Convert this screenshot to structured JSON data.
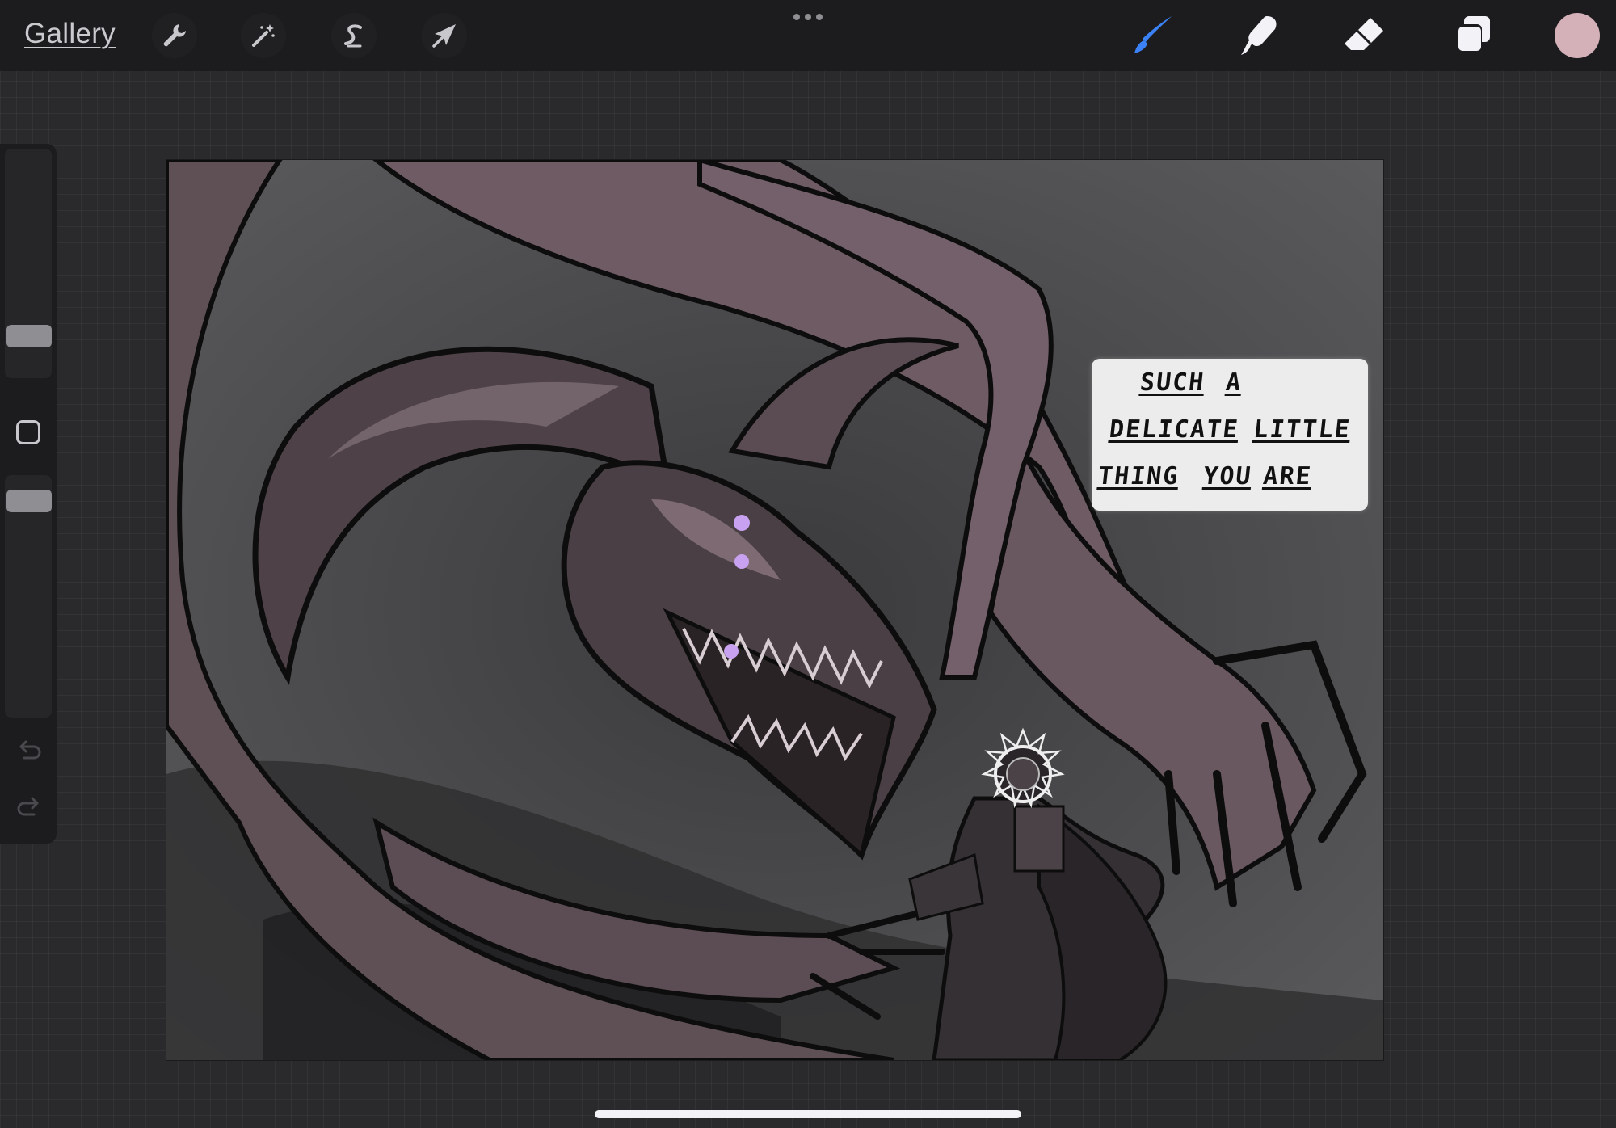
{
  "topbar": {
    "gallery_label": "Gallery",
    "tools": [
      {
        "name": "actions",
        "icon": "wrench-icon"
      },
      {
        "name": "adjustments",
        "icon": "magic-wand-icon"
      },
      {
        "name": "selection",
        "icon": "selection-s-icon"
      },
      {
        "name": "transform",
        "icon": "arrow-cursor-icon"
      }
    ],
    "more_icon": "ellipsis-icon",
    "right_tools": [
      {
        "name": "brush",
        "icon": "brush-icon",
        "active": true,
        "color": "#3b82f6"
      },
      {
        "name": "smudge",
        "icon": "smudge-icon",
        "active": false
      },
      {
        "name": "eraser",
        "icon": "eraser-icon",
        "active": false
      },
      {
        "name": "layers",
        "icon": "layers-icon",
        "active": false
      }
    ],
    "current_color": "#d4b1b8"
  },
  "sidebar": {
    "brush_size_slider": "brush-size",
    "modify_button_icon": "square-icon",
    "opacity_slider": "opacity",
    "undo_icon": "undo-icon",
    "redo_icon": "redo-icon"
  },
  "canvas": {
    "speech_bubble": {
      "lines": [
        [
          "SUCH",
          "A"
        ],
        [
          "DELICATE",
          "LITTLE"
        ],
        [
          "THING",
          "YOU",
          "ARE"
        ]
      ]
    }
  },
  "colors": {
    "background": "#2a2a2c",
    "toolbar": "#1c1c1e",
    "accent": "#3b82f6",
    "creature": "#6e5b63",
    "eyes": "#c8a2f0"
  }
}
